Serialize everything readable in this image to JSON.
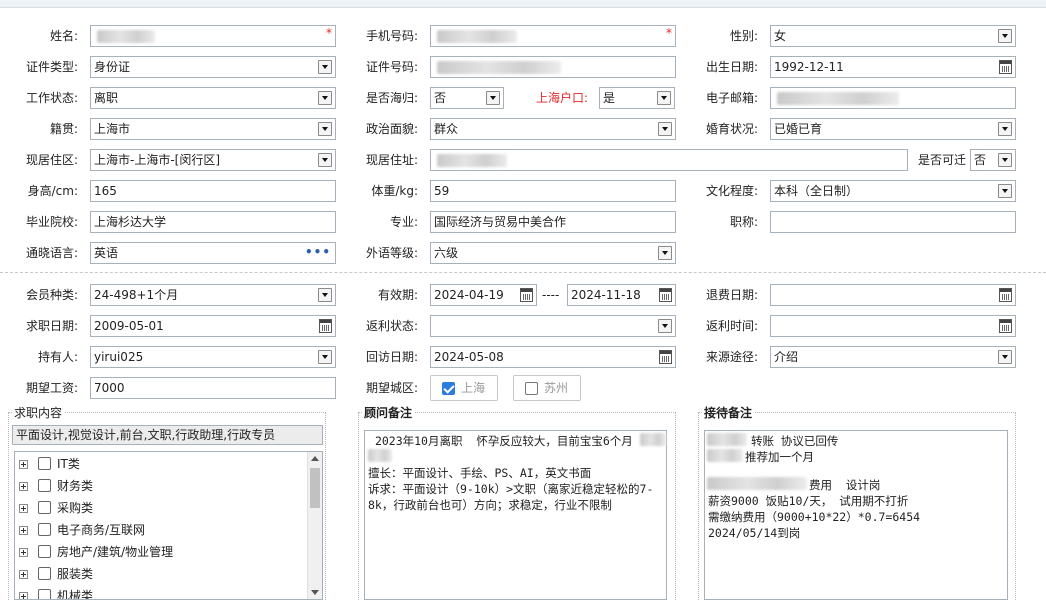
{
  "row1": {
    "name_label": "姓名:",
    "mobile_label": "手机号码:",
    "gender_label": "性别:",
    "gender_value": "女",
    "required_mark": "*"
  },
  "row2": {
    "id_type_label": "证件类型:",
    "id_type_value": "身份证",
    "id_number_label": "证件号码:",
    "birth_label": "出生日期:",
    "birth_value": "1992-12-11"
  },
  "row3": {
    "work_status_label": "工作状态:",
    "work_status_value": "离职",
    "overseas_label": "是否海归:",
    "overseas_value": "否",
    "shanghai_hukou_label": "上海户口:",
    "shanghai_hukou_value": "是",
    "email_label": "电子邮箱:"
  },
  "row4": {
    "native_label": "籍贯:",
    "native_value": "上海市",
    "political_label": "政治面貌:",
    "political_value": "群众",
    "marital_label": "婚育状况:",
    "marital_value": "已婚已育"
  },
  "row5": {
    "residence_label": "现居住区:",
    "residence_value": "上海市-上海市-[闵行区]",
    "address_label": "现居住址:",
    "relocate_label": "是否可迁",
    "relocate_value": "否"
  },
  "row6": {
    "height_label": "身高/cm:",
    "height_value": "165",
    "weight_label": "体重/kg:",
    "weight_value": "59",
    "education_label": "文化程度:",
    "education_value": "本科（全日制）"
  },
  "row7": {
    "school_label": "毕业院校:",
    "school_value": "上海杉达大学",
    "major_label": "专业:",
    "major_value": "国际经济与贸易中美合作",
    "title_label": "职称:"
  },
  "row8": {
    "language_label": "通晓语言:",
    "language_value": "英语",
    "language_more": "•••",
    "language_level_label": "外语等级:",
    "language_level_value": "六级"
  },
  "row9": {
    "member_type_label": "会员种类:",
    "member_type_value": "24-498+1个月",
    "valid_label": "有效期:",
    "valid_from": "2024-04-19",
    "valid_sep": "----",
    "valid_to": "2024-11-18",
    "refund_date_label": "退费日期:"
  },
  "row10": {
    "job_date_label": "求职日期:",
    "job_date_value": "2009-05-01",
    "rebate_status_label": "返利状态:",
    "rebate_time_label": "返利时间:"
  },
  "row11": {
    "holder_label": "持有人:",
    "holder_value": "yirui025",
    "callback_label": "回访日期:",
    "callback_value": "2024-05-08",
    "source_label": "来源途径:",
    "source_value": "介绍"
  },
  "row12": {
    "salary_label": "期望工资:",
    "salary_value": "7000",
    "city_label": "期望城区:",
    "city_options": [
      "上海",
      "苏州"
    ]
  },
  "job_panel": {
    "title": "求职内容",
    "selected": "平面设计,视觉设计,前台,文职,行政助理,行政专员",
    "categories": [
      "IT类",
      "财务类",
      "采购类",
      "电子商务/互联网",
      "房地产/建筑/物业管理",
      "服装类",
      "机械类"
    ]
  },
  "advisor_panel": {
    "title": "顾问备注",
    "text": " 2023年10月离职  怀孕反应较大，目前宝宝6个月\n\n擅长：平面设计、手绘、PS、AI，英文书面\n诉求：平面设计（9-10k）>文职（离家近稳定轻松的7-8k，行政前台也可）方向；求稳定，行业不限制"
  },
  "reception_panel": {
    "title": "接待备注",
    "line1": "转账 协议已回传",
    "line2": "推荐加一个月",
    "line3": "费用  设计岗",
    "line4": "薪资9000 饭贴10/天， 试用期不打折",
    "line5": "需缴纳费用（9000+10*22）*0.7=6454",
    "line6": "2024/05/14到岗"
  },
  "colors": {
    "required": "#e0282a",
    "accent": "#2d7ce0",
    "border": "#a7b1bc"
  }
}
